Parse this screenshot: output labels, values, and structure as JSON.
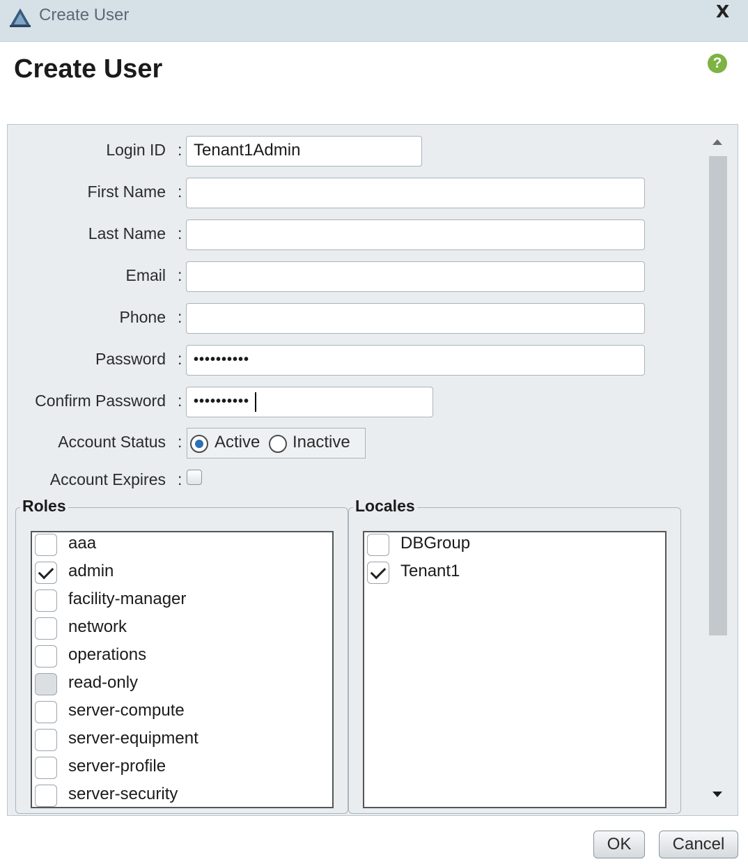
{
  "window": {
    "title": "Create User",
    "close_label": "X"
  },
  "heading": "Create User",
  "help_label": "?",
  "form": {
    "login_id": {
      "label": "Login ID",
      "value": "Tenant1Admin"
    },
    "first_name": {
      "label": "First Name",
      "value": ""
    },
    "last_name": {
      "label": "Last Name",
      "value": ""
    },
    "email": {
      "label": "Email",
      "value": ""
    },
    "phone": {
      "label": "Phone",
      "value": ""
    },
    "password": {
      "label": "Password",
      "value": "••••••••••"
    },
    "confirm_password": {
      "label": "Confirm Password",
      "value": "••••••••••"
    },
    "account_status": {
      "label": "Account Status",
      "options": [
        "Active",
        "Inactive"
      ],
      "selected": "Active"
    },
    "account_expires": {
      "label": "Account Expires",
      "checked": false
    },
    "colon": ":"
  },
  "roles": {
    "legend": "Roles",
    "items": [
      {
        "label": "aaa",
        "state": "unchecked"
      },
      {
        "label": "admin",
        "state": "checked"
      },
      {
        "label": "facility-manager",
        "state": "unchecked"
      },
      {
        "label": "network",
        "state": "unchecked"
      },
      {
        "label": "operations",
        "state": "unchecked"
      },
      {
        "label": "read-only",
        "state": "disabled"
      },
      {
        "label": "server-compute",
        "state": "unchecked"
      },
      {
        "label": "server-equipment",
        "state": "unchecked"
      },
      {
        "label": "server-profile",
        "state": "unchecked"
      },
      {
        "label": "server-security",
        "state": "unchecked"
      }
    ]
  },
  "locales": {
    "legend": "Locales",
    "items": [
      {
        "label": "DBGroup",
        "state": "unchecked"
      },
      {
        "label": "Tenant1",
        "state": "checked"
      }
    ]
  },
  "buttons": {
    "ok": "OK",
    "cancel": "Cancel"
  }
}
